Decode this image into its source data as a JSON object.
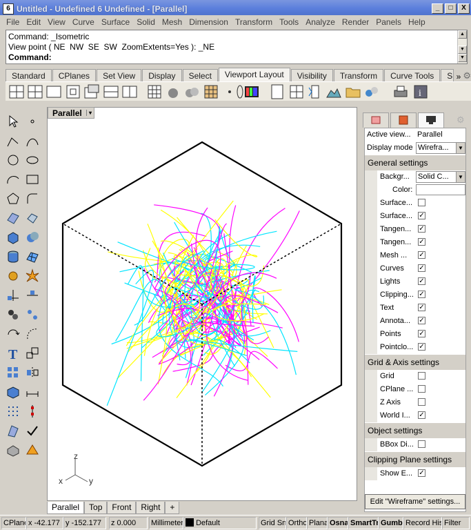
{
  "window": {
    "title": "Untitled - Undefined 6 Undefined - [Parallel]",
    "app_icon": "rhino-icon",
    "minimize_label": "_",
    "maximize_label": "□",
    "close_label": "X"
  },
  "menu": [
    "File",
    "Edit",
    "View",
    "Curve",
    "Surface",
    "Solid",
    "Mesh",
    "Dimension",
    "Transform",
    "Tools",
    "Analyze",
    "Render",
    "Panels",
    "Help"
  ],
  "command": {
    "history_1": "Command: _Isometric",
    "history_2": "View point ( NE  NW  SE  SW  ZoomExtents=Yes ): _NE",
    "prompt": "Command:"
  },
  "toolbar_tabs": [
    "Standard",
    "CPlanes",
    "Set View",
    "Display",
    "Select",
    "Viewport Layout",
    "Visibility",
    "Transform",
    "Curve Tools",
    "Surface To"
  ],
  "toolbar_tabs_active": "Viewport Layout",
  "toolbar_tabs_more": "»",
  "viewport": {
    "title": "Parallel",
    "dropdown": "▾",
    "tabs": [
      "Parallel",
      "Top",
      "Front",
      "Right"
    ],
    "add_tab": "+",
    "axis_z": "z",
    "axis_x": "x",
    "axis_y": "y",
    "curve_colors": [
      "#ffff00",
      "#00e5ff",
      "#ff00ff"
    ]
  },
  "panel": {
    "rows": [
      {
        "label": "Active view...",
        "value": "Parallel"
      },
      {
        "label": "Display mode",
        "value": "Wirefra..."
      }
    ],
    "general": {
      "title": "General settings",
      "background_label": "Backgr...",
      "background_value": "Solid C...",
      "color_label": "Color:",
      "checks": [
        {
          "label": "Surface...",
          "checked": false
        },
        {
          "label": "Surface...",
          "checked": true
        },
        {
          "label": "Tangen...",
          "checked": true
        },
        {
          "label": "Tangen...",
          "checked": true
        },
        {
          "label": "Mesh ...",
          "checked": true
        },
        {
          "label": "Curves",
          "checked": true
        },
        {
          "label": "Lights",
          "checked": true
        },
        {
          "label": "Clipping...",
          "checked": true
        },
        {
          "label": "Text",
          "checked": true
        },
        {
          "label": "Annota...",
          "checked": true
        },
        {
          "label": "Points",
          "checked": true
        },
        {
          "label": "Pointclo...",
          "checked": true
        }
      ]
    },
    "grid": {
      "title": "Grid & Axis settings",
      "checks": [
        {
          "label": "Grid",
          "checked": false
        },
        {
          "label": "CPlane ...",
          "checked": false
        },
        {
          "label": "Z Axis",
          "checked": false
        },
        {
          "label": "World I...",
          "checked": true
        }
      ]
    },
    "object": {
      "title": "Object settings",
      "checks": [
        {
          "label": "BBox Di...",
          "checked": false
        }
      ]
    },
    "clipping": {
      "title": "Clipping Plane settings",
      "checks": [
        {
          "label": "Show E...",
          "checked": true
        }
      ]
    },
    "edit_button": "Edit \"Wireframe\" settings..."
  },
  "status": {
    "cplane": "CPlane",
    "x": "x -42.177",
    "y": "y -152.177",
    "z": "z 0.000",
    "units": "Millimeters",
    "layer": "Default",
    "grid_snap": "Grid Snap",
    "ortho": "Ortho",
    "planar": "Planar",
    "osnap": "Osnap",
    "smarttrack": "SmartTrack",
    "gumball": "Gumball",
    "record_history": "Record History",
    "filter": "Filter"
  }
}
